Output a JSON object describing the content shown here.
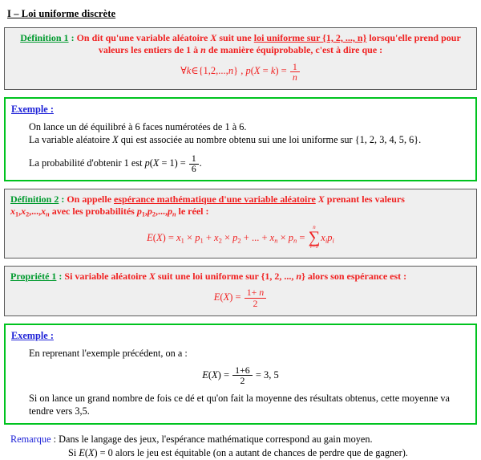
{
  "document": {
    "section_title": "I – Loi uniforme discrète"
  },
  "definition1": {
    "label": "Définition 1",
    "colon": " : ",
    "text_a": "On dit qu'une variable aléatoire ",
    "var_x": "X",
    "text_b": " suit une ",
    "emphasis": "loi uniforme sur {1, 2, ..., n}",
    "text_c": " lorsqu'elle prend pour",
    "text_line2_a": "valeurs les entiers de 1 à ",
    "var_n": "n",
    "text_line2_b": " de manière équiprobable, c'est à dire que :",
    "formula": {
      "forall": "∀",
      "k": "k",
      "in": "∈",
      "set": "{1,2,...,",
      "set_n": "n",
      "set_close": "}",
      "comma": " , ",
      "p": "p",
      "paren_open": "(",
      "x": "X",
      "equals1": " = ",
      "k2": "k",
      "paren_close": ")",
      "equals2": " = ",
      "frac_num": "1",
      "frac_den": "n"
    }
  },
  "example1": {
    "label": "Exemple :",
    "line1": "On lance un dé équilibré à 6 faces numérotées de 1 à 6.",
    "line2_a": "La variable aléatoire ",
    "line2_x": "X",
    "line2_b": " qui est associée au nombre obtenu sui une loi uniforme sur {1, 2, 3, 4, 5, 6}.",
    "line3_a": "La probabilité d'obtenir 1 est ",
    "line3_formula": {
      "p": "p",
      "paren_open": "(",
      "x": "X",
      "equals1": " = 1)",
      "equals2": " = ",
      "frac_num": "1",
      "frac_den": "6",
      "period": "."
    }
  },
  "definition2": {
    "label": "Définition 2",
    "colon": " : ",
    "text_a": "On appelle ",
    "emphasis": "espérance mathématique d'une variable aléatoire",
    "var_x": " X",
    "text_b": " prenant les valeurs",
    "line2": {
      "x1": "x",
      "x1s": "1",
      "x2": "x",
      "x2s": "2",
      "dots": ",...,",
      "xn": "x",
      "xns": "n",
      "mid": " avec les probabilités  ",
      "p1": "p",
      "p1s": "1",
      "p2": "p",
      "p2s": "2",
      "pdots": ",...,",
      "pn": "p",
      "pns": "n",
      "end": " le réel :"
    },
    "formula": {
      "ex": "E",
      "paren_open": "(",
      "x": "X",
      "paren_close": ")",
      "eq": " = ",
      "t1x": "x",
      "t1s": "1",
      "times1": " × ",
      "t1p": "p",
      "t1ps": "1",
      "plus1": " + ",
      "t2x": "x",
      "t2s": "2",
      "times2": " × ",
      "t2p": "p",
      "t2ps": "2",
      "plus2": " + ... + ",
      "tnx": "x",
      "tns": "n",
      "times3": " × ",
      "tnp": "p",
      "tnps": "n",
      "eq2": " = ",
      "sigma_top": "n",
      "sigma_sym": "∑",
      "sigma_bot": "i=1",
      "sum_x": "x",
      "sum_xs": "i",
      "sum_p": "p",
      "sum_ps": "i"
    }
  },
  "propriete1": {
    "label": "Propriété 1",
    "colon": " : ",
    "text": "Si variable aléatoire ",
    "var_x": "X",
    "text_b": " suit une loi uniforme sur {1, 2, ..., ",
    "var_n": "n",
    "text_c": "} alors son espérance est :",
    "formula": {
      "ex": "E",
      "paren_open": "(",
      "x": "X",
      "paren_close": ")",
      "eq": " = ",
      "frac_num_a": "1+ ",
      "frac_num_n": "n",
      "frac_den": "2"
    }
  },
  "example2": {
    "label": "Exemple :",
    "line1": "En reprenant l'exemple précédent, on a :",
    "formula": {
      "ex": "E",
      "paren_open": "(",
      "x": "X",
      "paren_close": ")",
      "eq": " = ",
      "frac_num": "1+6",
      "frac_den": "2",
      "eq2": " = ",
      "result": "3, 5"
    },
    "line2": "Si on lance un grand nombre de fois ce dé et qu'on fait la moyenne des résultats obtenus, cette moyenne va tendre vers 3,5."
  },
  "remarque": {
    "label": "Remarque",
    "colon": " : ",
    "line1": "Dans le langage des jeux, l'espérance mathématique correspond au gain moyen.",
    "line2_a": "Si ",
    "line2_formula": {
      "ex": "E",
      "paren_open": "(",
      "x": "X",
      "paren_close": ")",
      "eq": " = 0"
    },
    "line2_b": "  alors le jeu est équitable (on a autant de chances de perdre que de gagner)."
  },
  "colors": {
    "green_label": "#009a2e",
    "red_body": "#f02020",
    "blue_label": "#1e22d7",
    "box_border_gray": "#5a5a5a",
    "box_bg_gray": "#efefef",
    "box_border_green": "#00c31f"
  }
}
